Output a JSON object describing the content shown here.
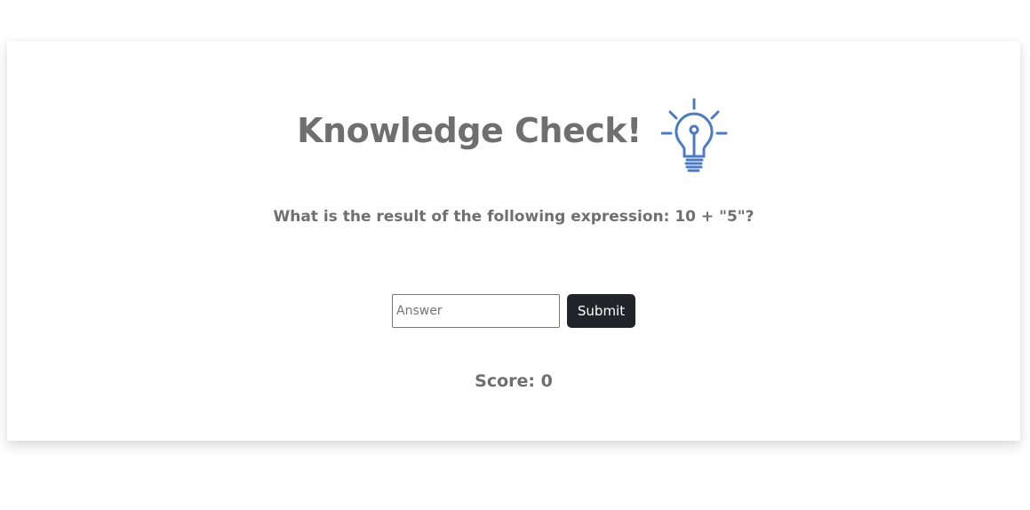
{
  "quiz": {
    "title": "Knowledge Check!",
    "icon": "lightbulb-icon",
    "icon_color": "#4a7bc4",
    "question": "What is the result of the following expression: 10 + \"5\"?",
    "answer_placeholder": "Answer",
    "answer_value": "",
    "submit_label": "Submit",
    "score_label": "Score: 0"
  },
  "colors": {
    "text": "#6f6f6f",
    "button_bg": "#212529",
    "button_text": "#ffffff"
  }
}
